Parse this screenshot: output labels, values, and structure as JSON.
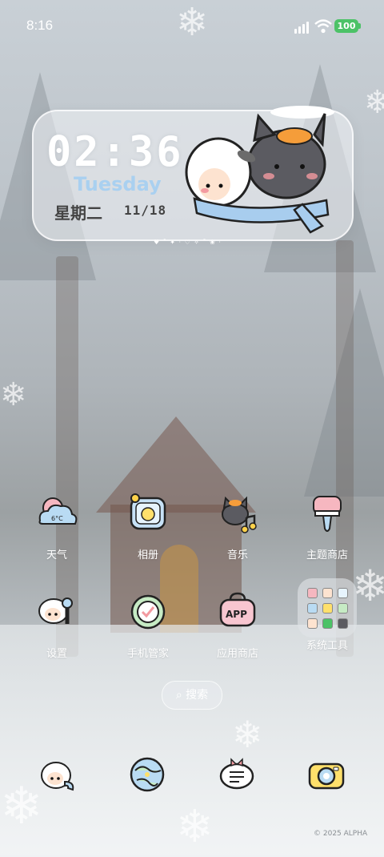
{
  "status_bar": {
    "time": "8:16",
    "battery": "100",
    "battery_color": "#4cc267"
  },
  "widget": {
    "clock": "02:36",
    "weekday_en": "Tuesday",
    "weekday_cn": "星期二",
    "date": "11/18"
  },
  "apps": [
    {
      "label": "天气",
      "icon": "weather-cloud-icon",
      "badge": "6°C"
    },
    {
      "label": "相册",
      "icon": "photo-album-chick-icon"
    },
    {
      "label": "音乐",
      "icon": "music-cat-icon"
    },
    {
      "label": "主题商店",
      "icon": "theme-paintbrush-icon"
    },
    {
      "label": "设置",
      "icon": "settings-sheep-icon"
    },
    {
      "label": "手机管家",
      "icon": "phone-manager-shield-icon"
    },
    {
      "label": "应用商店",
      "icon": "app-store-icon",
      "badge": "APP"
    },
    {
      "label": "系统工具",
      "icon": "system-tools-folder-icon"
    }
  ],
  "search": {
    "label": "搜索",
    "icon": "search-icon"
  },
  "dock": [
    {
      "icon": "phone-sheep-icon"
    },
    {
      "icon": "browser-globe-icon"
    },
    {
      "icon": "messages-bubble-icon"
    },
    {
      "icon": "camera-icon"
    }
  ],
  "copyright": "© 2025 ALPHA"
}
